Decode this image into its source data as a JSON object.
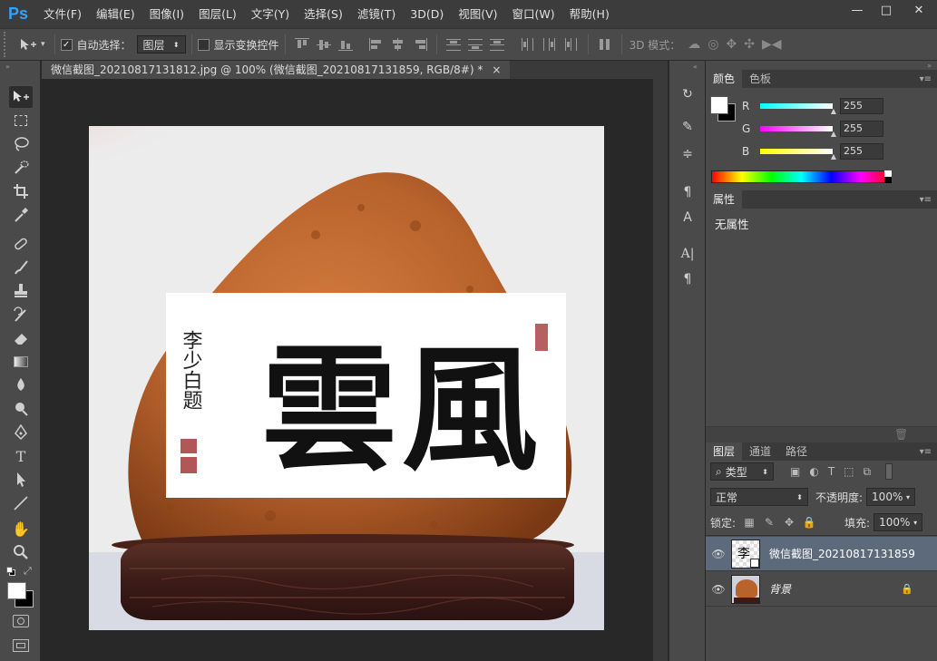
{
  "app": {
    "logo": "Ps"
  },
  "menu": [
    "文件(F)",
    "编辑(E)",
    "图像(I)",
    "图层(L)",
    "文字(Y)",
    "选择(S)",
    "滤镜(T)",
    "3D(D)",
    "视图(V)",
    "窗口(W)",
    "帮助(H)"
  ],
  "window_controls": {
    "minimize": "—",
    "restore": "□",
    "close": "✕"
  },
  "options": {
    "auto_select_label": "自动选择：",
    "auto_select_checked": true,
    "auto_select_target": "图层",
    "show_transform_label": "显示变换控件",
    "show_transform_checked": false,
    "mode_3d_label": "3D 模式："
  },
  "document": {
    "tab_title": "微信截图_20210817131812.jpg @ 100% (微信截图_20210817131859, RGB/8#) *",
    "close_glyph": "×"
  },
  "calligraphy": {
    "signature": "李少白题",
    "char_right": "風",
    "char_left": "雲"
  },
  "color_panel": {
    "tabs": [
      "颜色",
      "色板"
    ],
    "r_label": "R",
    "r_value": "255",
    "g_label": "G",
    "g_value": "255",
    "b_label": "B",
    "b_value": "255",
    "foreground": "#ffffff",
    "background": "#000000"
  },
  "properties_panel": {
    "tabs": [
      "属性"
    ],
    "empty_text": "无属性"
  },
  "layers_panel": {
    "tabs": [
      "图层",
      "通道",
      "路径"
    ],
    "filter_kind": "类型",
    "blend_mode": "正常",
    "opacity_label": "不透明度:",
    "opacity_value": "100%",
    "lock_label": "锁定:",
    "fill_label": "填充:",
    "fill_value": "100%",
    "layers": [
      {
        "name": "微信截图_20210817131859",
        "visible": true,
        "selected": true
      },
      {
        "name": "背景",
        "visible": true,
        "selected": false,
        "locked": true
      }
    ]
  },
  "icons": {
    "move-tool": "move-icon",
    "marquee": "marquee-icon",
    "lasso": "lasso-icon",
    "quick-select": "quick-select-icon",
    "crop": "crop-icon",
    "eyedropper": "eyedropper-icon",
    "healing": "healing-icon",
    "brush": "brush-icon",
    "stamp": "stamp-icon",
    "history-brush": "history-brush-icon",
    "eraser": "eraser-icon",
    "gradient": "gradient-icon",
    "blur": "blur-icon",
    "dodge": "dodge-icon",
    "pen": "pen-icon",
    "type": "type-icon",
    "path-select": "path-select-icon",
    "line": "line-icon",
    "hand": "hand-icon",
    "zoom": "zoom-icon"
  }
}
